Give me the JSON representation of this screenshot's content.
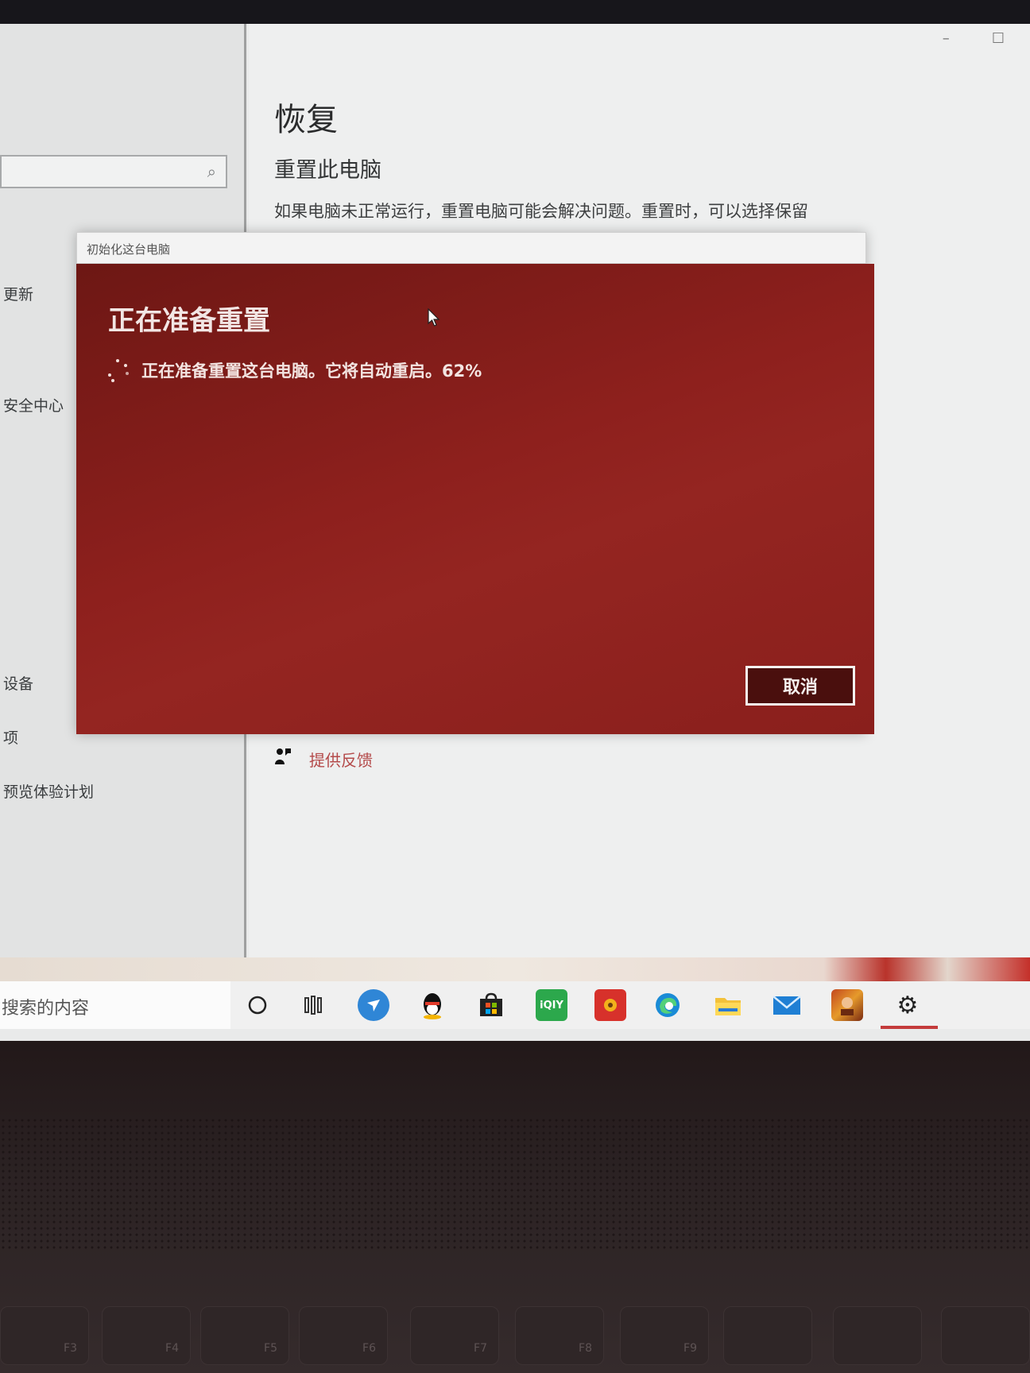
{
  "settings": {
    "page_title": "恢复",
    "section_title": "重置此电脑",
    "description": "如果电脑未正常运行，重置电脑可能会解决问题。重置时，可以选择保留",
    "window_controls": {
      "minimize": "–",
      "maximize": "☐"
    },
    "sidebar": {
      "items": [
        {
          "label": "更新"
        },
        {
          "label": "安全中心"
        },
        {
          "label": "设备"
        },
        {
          "label": "项"
        },
        {
          "label": "预览体验计划"
        }
      ]
    },
    "feedback": {
      "label": "提供反馈",
      "icon": "feedback-icon"
    }
  },
  "dialog": {
    "title": "初始化这台电脑",
    "heading": "正在准备重置",
    "progress_text": "正在准备重置这台电脑。它将自动重启。62%",
    "progress_percent": 62,
    "cancel_label": "取消",
    "body_color": "#8e201d"
  },
  "taskbar": {
    "search_placeholder": "搜索的内容",
    "icons": [
      "cortana-circle-icon",
      "task-view-icon",
      "feishu-icon",
      "qq-icon",
      "microsoft-store-icon",
      "iqiyi-icon",
      "app-red-icon",
      "edge-icon",
      "file-explorer-icon",
      "mail-icon",
      "game-icon",
      "settings-gear-icon"
    ]
  },
  "keyboard": {
    "keys": [
      "F3",
      "F4",
      "F5",
      "F6",
      "F7",
      "F8",
      "F9"
    ]
  }
}
